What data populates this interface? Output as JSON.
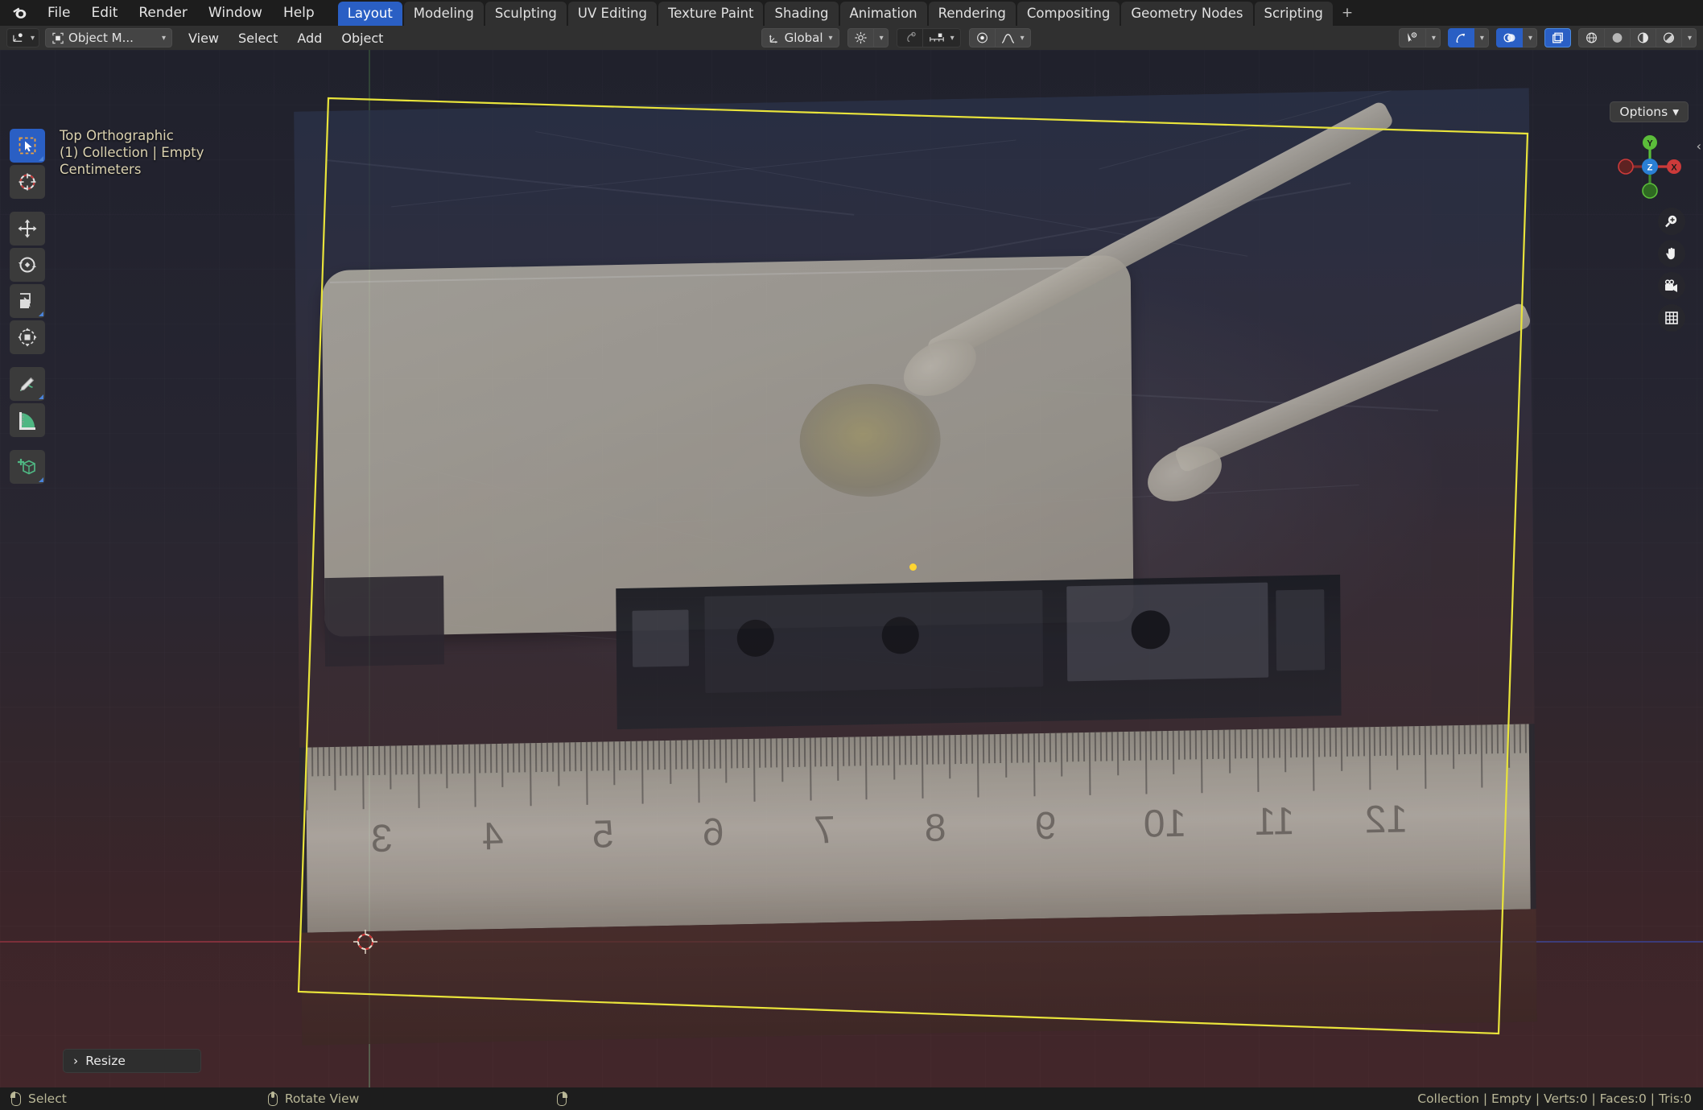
{
  "app": {
    "name": "Blender",
    "logo_icon": "blender-logo-icon"
  },
  "topbar": {
    "menus": [
      "File",
      "Edit",
      "Render",
      "Window",
      "Help"
    ],
    "workspaces": [
      {
        "label": "Layout",
        "active": true
      },
      {
        "label": "Modeling",
        "active": false
      },
      {
        "label": "Sculpting",
        "active": false
      },
      {
        "label": "UV Editing",
        "active": false
      },
      {
        "label": "Texture Paint",
        "active": false
      },
      {
        "label": "Shading",
        "active": false
      },
      {
        "label": "Animation",
        "active": false
      },
      {
        "label": "Rendering",
        "active": false
      },
      {
        "label": "Compositing",
        "active": false
      },
      {
        "label": "Geometry Nodes",
        "active": false
      },
      {
        "label": "Scripting",
        "active": false
      }
    ],
    "add_workspace_label": "+"
  },
  "viewport_header": {
    "editor_type_icon": "editor-type-3dview-icon",
    "mode_selector": {
      "label": "Object M...",
      "icon": "object-mode-icon"
    },
    "menus": [
      "View",
      "Select",
      "Add",
      "Object"
    ],
    "select_modes": [
      "tweak",
      "box-select",
      "circle-select",
      "lasso-select",
      "select-box-alt"
    ],
    "transform_orientation": {
      "label": "Global",
      "icon": "orientation-axes-icon"
    },
    "snap": {
      "icon": "snap-magnet-icon",
      "enabled": false
    },
    "proportional_edit": {
      "icon": "proportional-edit-icon",
      "falloff_icon": "falloff-smooth-icon"
    },
    "pivot": {
      "icon": "pivot-median-point-icon"
    },
    "right_controls": [
      {
        "name": "visibility-selector",
        "icon": "eye-cursor-icon"
      },
      {
        "name": "gizmo-toggle",
        "icon": "gizmo-icon",
        "active": true
      },
      {
        "name": "overlays-toggle",
        "icon": "overlays-icon",
        "active": true
      },
      {
        "name": "xray-toggle",
        "icon": "xray-icon",
        "active": true
      },
      {
        "name": "shading-wireframe",
        "icon": "shading-wireframe-icon"
      },
      {
        "name": "shading-solid",
        "icon": "shading-solid-icon",
        "active": true
      },
      {
        "name": "shading-material",
        "icon": "shading-material-icon"
      },
      {
        "name": "shading-rendered",
        "icon": "shading-rendered-icon"
      }
    ]
  },
  "viewport": {
    "options_button": "Options",
    "overlay_text": {
      "view_name": "Top Orthographic",
      "collection_object": "(1) Collection | Empty",
      "units": "Centimeters"
    },
    "gizmo_axes": [
      {
        "label": "X",
        "color": "#e04a4a"
      },
      {
        "label": "Y",
        "color": "#5bbd3a"
      },
      {
        "label": "Z",
        "color": "#2a7fd4"
      }
    ],
    "nav_buttons": [
      "zoom-icon",
      "pan-hand-icon",
      "camera-view-icon",
      "toggle-perspective-icon"
    ],
    "sidebar_toggle_icon": "chevron-left-icon",
    "selection_color": "#e9e43b",
    "cursor_3d_icon": "cursor-3d-icon"
  },
  "toolbar": [
    {
      "name": "tweak-tool",
      "icon": "cursor-arrow-icon",
      "active": true
    },
    {
      "name": "cursor-tool",
      "icon": "cursor-3d-tool-icon",
      "active": false
    },
    {
      "name": "move-tool",
      "icon": "move-arrows-icon",
      "active": false
    },
    {
      "name": "rotate-tool",
      "icon": "rotate-icon",
      "active": false
    },
    {
      "name": "scale-tool",
      "icon": "scale-icon",
      "active": false
    },
    {
      "name": "transform-tool",
      "icon": "transform-icon",
      "active": false
    },
    {
      "name": "annotate-tool",
      "icon": "pencil-icon",
      "active": false
    },
    {
      "name": "measure-tool",
      "icon": "ruler-icon",
      "active": false
    },
    {
      "name": "add-cube-tool",
      "icon": "add-cube-icon",
      "active": false
    }
  ],
  "operator_panel": {
    "label": "Resize",
    "expand_icon": "chevron-right-icon",
    "collapsed": true
  },
  "statusbar": {
    "hints": [
      {
        "icon": "mouse-left-icon",
        "label": "Select"
      },
      {
        "icon": "mouse-middle-icon",
        "label": "Rotate View"
      },
      {
        "icon": "mouse-right-icon",
        "label": ""
      }
    ],
    "scene_stats": "Collection | Empty | Verts:0 | Faces:0 | Tris:0"
  },
  "ruler_numbers": [
    "3",
    "4",
    "5",
    "6",
    "7",
    "8",
    "9",
    "10",
    "11",
    "12"
  ]
}
